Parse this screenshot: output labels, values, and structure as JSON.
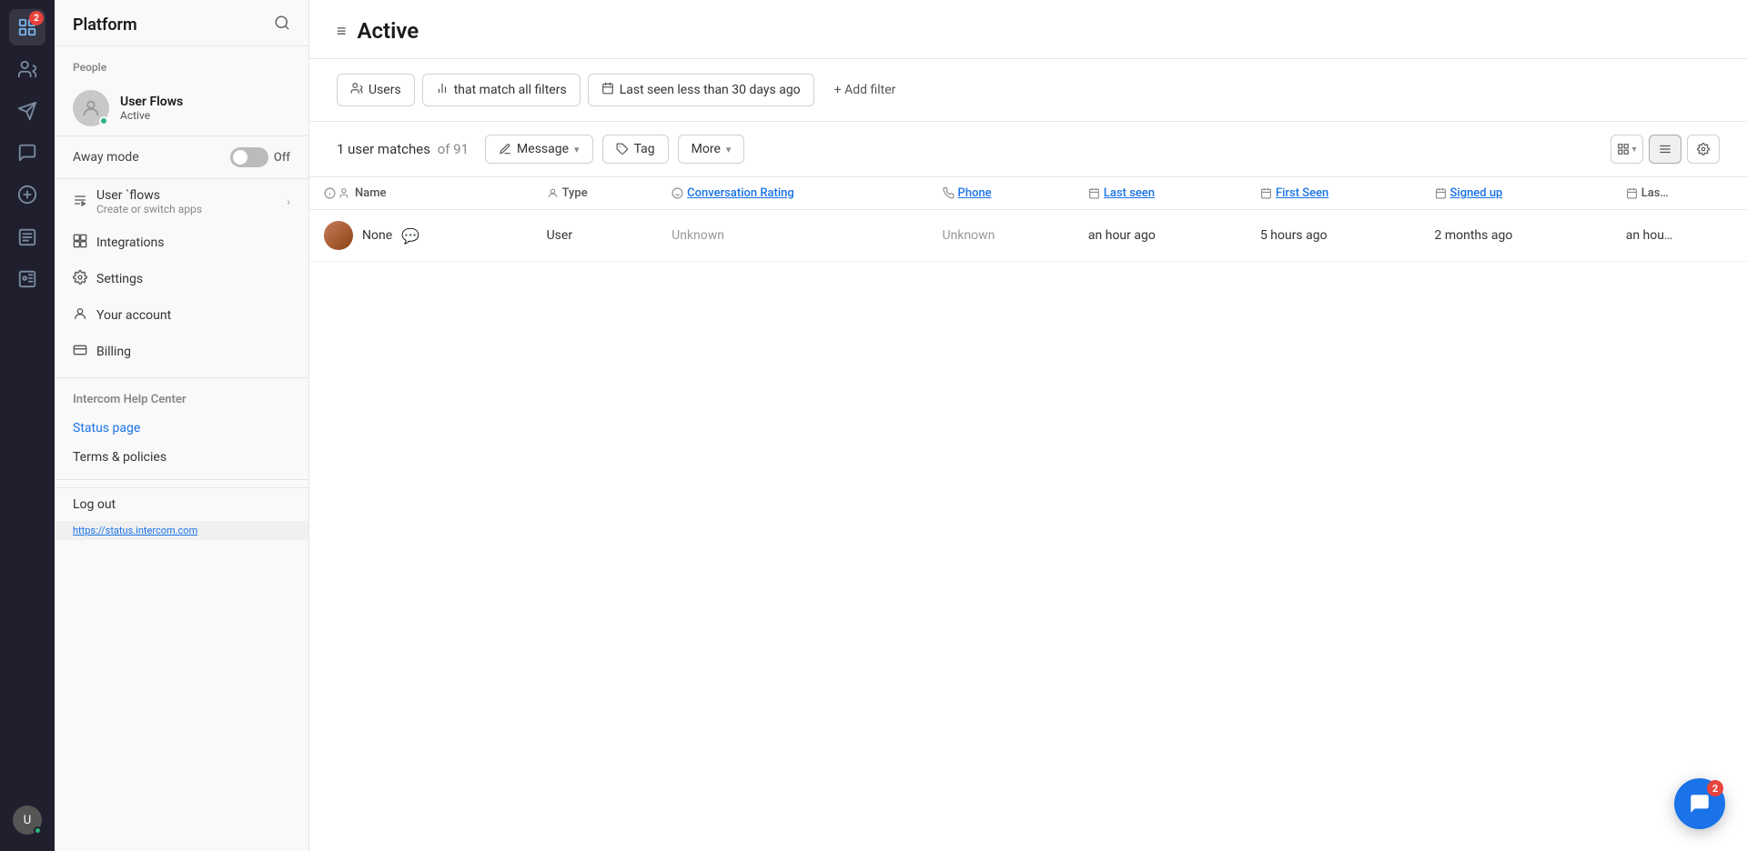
{
  "iconRail": {
    "badge": "2",
    "icons": [
      "🏠",
      "👥",
      "✈️",
      "💬",
      "➕",
      "📋",
      "➕"
    ]
  },
  "sidebar": {
    "title": "Platform",
    "searchIcon": "🔍",
    "sectionLabel": "People",
    "userCard": {
      "name": "User Flows",
      "status": "Active"
    },
    "awayMode": {
      "label": "Away mode",
      "toggleState": "Off"
    },
    "navItems": [
      {
        "icon": "❖",
        "label": "User `flows",
        "sublabel": "Create or switch apps",
        "hasChevron": true
      },
      {
        "icon": "⚙",
        "label": "Integrations",
        "hasChevron": false
      },
      {
        "icon": "⚙",
        "label": "Settings",
        "hasChevron": false
      },
      {
        "icon": "👤",
        "label": "Your account",
        "hasChevron": false
      },
      {
        "icon": "💳",
        "label": "Billing",
        "hasChevron": false
      }
    ],
    "helpSection": {
      "title": "Intercom Help Center",
      "links": [
        {
          "label": "Status page",
          "isBlue": true
        },
        {
          "label": "Terms & policies",
          "isBlue": false
        }
      ]
    },
    "logOut": "Log out",
    "statusUrl": "https://status.intercom.com"
  },
  "main": {
    "hamburgerLabel": "≡",
    "title": "Active",
    "filters": [
      {
        "icon": "👥",
        "label": "Users"
      },
      {
        "icon": "📊",
        "label": "that match all filters"
      },
      {
        "icon": "📅",
        "label": "Last seen less than 30 days ago"
      }
    ],
    "addFilter": "+ Add filter",
    "toolbar": {
      "matchesText": "1 user matches",
      "ofTotal": "of 91",
      "messageBtn": "Message",
      "tagBtn": "Tag",
      "moreBtn": "More",
      "viewIcons": [
        "⊞",
        "☰",
        "⚙"
      ]
    },
    "table": {
      "columns": [
        {
          "icon": "ℹ",
          "label": "Name",
          "isLink": false
        },
        {
          "icon": "👤",
          "label": "Type",
          "isLink": false
        },
        {
          "icon": "😊",
          "label": "Conversation Rating",
          "isLink": true
        },
        {
          "icon": "📞",
          "label": "Phone",
          "isLink": true
        },
        {
          "icon": "📅",
          "label": "Last seen",
          "isLink": true
        },
        {
          "icon": "📅",
          "label": "First Seen",
          "isLink": true
        },
        {
          "icon": "📅",
          "label": "Signed up",
          "isLink": true
        },
        {
          "icon": "📅",
          "label": "Las…",
          "isLink": false
        }
      ],
      "rows": [
        {
          "name": "None",
          "hasChat": true,
          "type": "User",
          "conversationRating": "Unknown",
          "phone": "Unknown",
          "lastSeen": "an hour ago",
          "firstSeen": "5 hours ago",
          "signedUp": "2 months ago",
          "lastCol": "an hou…"
        }
      ]
    }
  },
  "chatFab": {
    "badge": "2"
  }
}
